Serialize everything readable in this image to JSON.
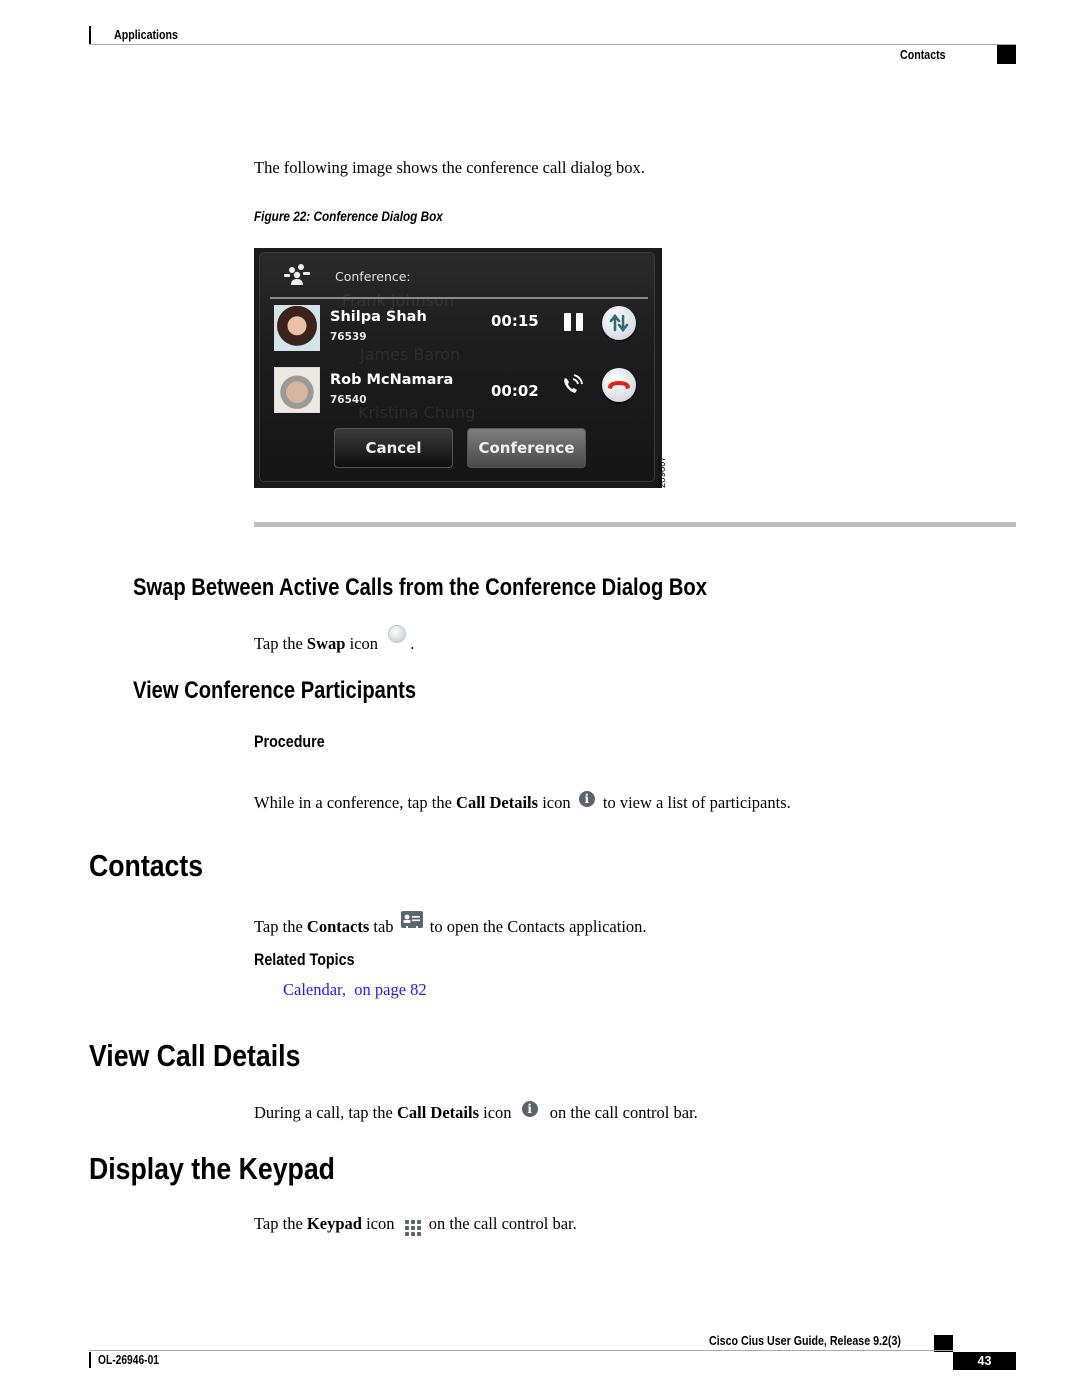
{
  "header": {
    "chapter": "Applications",
    "section": "Contacts"
  },
  "intro_text": "The following image shows the conference call dialog box.",
  "figure": {
    "caption": "Figure 22: Conference Dialog Box",
    "figure_id": "209607",
    "dialog": {
      "title": "Conference:",
      "title_icon": "conference-people-icon",
      "background_ghost_names": [
        "Frank Johnson",
        "James Baron",
        "Kristina Chung"
      ],
      "participants": [
        {
          "name": "Shilpa Shah",
          "number": "76539",
          "duration": "00:15",
          "state_icon": "pause-icon",
          "action_icon": "swap-icon"
        },
        {
          "name": "Rob McNamara",
          "number": "76540",
          "duration": "00:02",
          "state_icon": "ringing-phone-icon",
          "action_icon": "end-call-icon"
        }
      ],
      "buttons": {
        "cancel": "Cancel",
        "conference": "Conference"
      }
    }
  },
  "sections": {
    "swap": {
      "heading": "Swap Between Active Calls from the Conference Dialog Box",
      "text_before": "Tap the ",
      "bold": "Swap",
      "text_after": " icon",
      "text_end": "."
    },
    "view_participants": {
      "heading": "View Conference Participants",
      "procedure_label": "Procedure",
      "text_before": "While in a conference, tap the ",
      "bold": "Call Details",
      "text_mid": " icon",
      "text_after": "to view a list of participants."
    },
    "contacts": {
      "heading": "Contacts",
      "text_before": "Tap the ",
      "bold": "Contacts",
      "text_mid": " tab",
      "text_after": "to open the Contacts application.",
      "related_label": "Related Topics",
      "related_link": "Calendar,  on page 82"
    },
    "call_details": {
      "heading": "View Call Details",
      "text_before": "During a call, tap the ",
      "bold": "Call Details",
      "text_mid": " icon",
      "text_after": "on the call control bar."
    },
    "keypad": {
      "heading": "Display the Keypad",
      "text_before": "Tap the ",
      "bold": "Keypad",
      "text_mid": " icon",
      "text_after": "on the call control bar."
    }
  },
  "footer": {
    "doc_number": "OL-26946-01",
    "guide_title": "Cisco Cius User Guide, Release 9.2(3)",
    "page_number": "43"
  },
  "colors": {
    "link": "#1a1aff",
    "end_call_red": "#e2231a",
    "swap_arrows": "#2e6e7a"
  }
}
